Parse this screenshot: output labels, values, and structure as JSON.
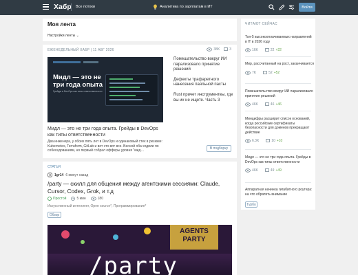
{
  "header": {
    "logo": "Хабр",
    "all_flows": "Все потоки",
    "promo": "Аналитика по зарплатам в ИТ",
    "login": "Войти",
    "icons": [
      "menu-icon",
      "search-icon",
      "pencil-icon",
      "settings-icon"
    ]
  },
  "feed": {
    "title": "Моя лента",
    "settings": "Настройки ленты"
  },
  "digest": {
    "header": "ЕЖЕНЕДЕЛЬНЫЙ ХАБР | 11 АВГ 2026",
    "views": "38K",
    "comments": "3",
    "image_title": "Мидл — это не три года опыта",
    "image_sub": "Грейды в DevOps как типы ответственности",
    "title": "Мидл — это не три года опыта. Грейды в DevOps как типы ответственности",
    "desc": "Два инженера, у обоих пять лет в DevOps и одинаковый стек в резюме: Kubernetes, Terraform, GitLab и вот это вот все. Весной оба ходили по собеседованиям, но первый собрал офферы уровня \"мид…",
    "list": [
      "Помешательство вокруг ИИ парализовало принятие решений",
      "Дефекты трафаретного нанесения паяльной пасты",
      "Rust причет инструментвы, где вы их не ищете. Часть 3"
    ],
    "more_button": "В подборку"
  },
  "article": {
    "tag": "СТАТЬЯ",
    "author": "1gr14",
    "time": "6 минут назад",
    "title": "/party — скилл для общения между агентскими сессиями: Claude, Cursor, Codex, Grok, и т.д",
    "level": "Простой",
    "read_time": "5 мин",
    "views": "180",
    "hubs": "Искусственный интеллект, Open source*, Программирование*",
    "review": "Обзор",
    "image_text": "/party",
    "banner_text": "AGENTS PARTY"
  },
  "sidebar": {
    "title": "ЧИТАЮТ СЕЙЧАС",
    "items": [
      {
        "title": "Топ-5 высокооплачиваемых направлений в IT в 2026 году",
        "views": "16K",
        "comments": "22",
        "delta": "+22"
      },
      {
        "title": "Мир, рассчитанный на рост, заканчивается",
        "views": "7K",
        "comments": "52",
        "delta": "+52"
      },
      {
        "title": "Помешательство вокруг ИИ парализовало принятие решений",
        "views": "46K",
        "comments": "46",
        "delta": "+46"
      },
      {
        "title": "Минцифры расширит список оснований, когда российские сертификаты безопасности для доменов прекращают действие",
        "views": "6.3K",
        "comments": "10",
        "delta": "+10"
      },
      {
        "title": "Мидл — это не три года опыта. Грейды в DevOps как типы ответственности",
        "views": "46K",
        "comments": "49",
        "delta": "+49"
      },
      {
        "title": "Аппаратная начинка гигабитного роутера: на что обратить внимание",
        "views": "",
        "comments": "",
        "delta": ""
      }
    ],
    "more": "Турбо"
  },
  "colors": {
    "header_bg": "#303b44",
    "login_btn": "#5b92bc",
    "accent": "#5c8bae",
    "positive": "#6aa84f"
  }
}
